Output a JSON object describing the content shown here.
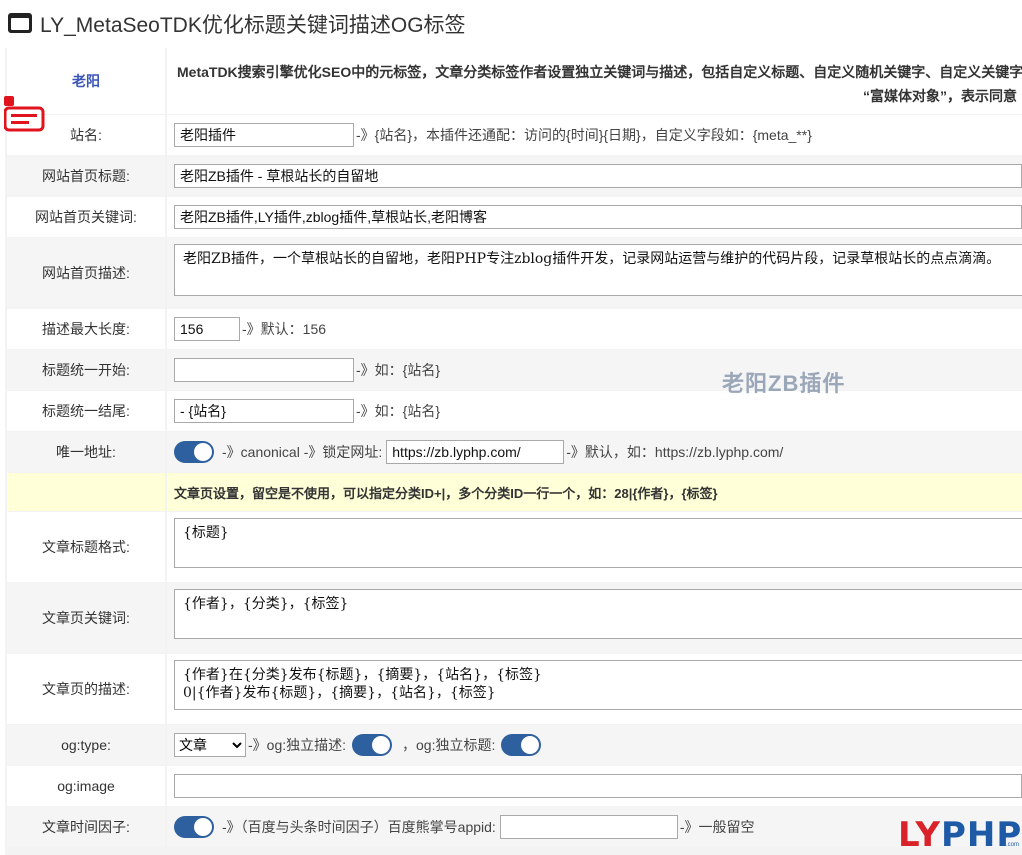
{
  "header": {
    "title": "LY_MetaSeoTDK优化标题关键词描述OG标签"
  },
  "intro": {
    "author": "老阳",
    "line1": "MetaTDK搜索引擎优化SEO中的元标签，文章分类标签作者设置独立关键词与描述，包括自定义标题、自定义随机关键字、自定义关键字",
    "line2": "“富媒体对象”，表示同意"
  },
  "rows": {
    "site_name": {
      "label": "站名:",
      "value": "老阳插件",
      "hint": "-》{站名}，本插件还通配：访问的{时间}{日期}，自定义字段如：{meta_**}"
    },
    "home_title": {
      "label": "网站首页标题:",
      "value": "老阳ZB插件 - 草根站长的自留地"
    },
    "home_keywords": {
      "label": "网站首页关键词:",
      "value": "老阳ZB插件,LY插件,zblog插件,草根站长,老阳博客"
    },
    "home_desc": {
      "label": "网站首页描述:",
      "value": "老阳ZB插件，一个草根站长的自留地，老阳PHP专注zblog插件开发，记录网站运营与维护的代码片段，记录草根站长的点点滴滴。"
    },
    "desc_maxlen": {
      "label": "描述最大长度:",
      "value": "156",
      "hint": "-》默认：156"
    },
    "title_prefix": {
      "label": "标题统一开始:",
      "value": "",
      "hint": "-》如：{站名}"
    },
    "title_suffix": {
      "label": "标题统一结尾:",
      "value": "- {站名}",
      "hint": "-》如：{站名}"
    },
    "canonical": {
      "label": "唯一地址:",
      "hint1": "-》canonical -》锁定网址:",
      "value": "https://zb.lyphp.com/",
      "hint2": "-》默认，如：https://zb.lyphp.com/"
    },
    "article_note": {
      "text": "文章页设置，留空是不使用，可以指定分类ID+|，多个分类ID一行一个，如：28|{作者}，{标签}"
    },
    "article_title": {
      "label": "文章标题格式:",
      "value": "{标题}"
    },
    "article_keywords": {
      "label": "文章页关键词:",
      "value": "{作者}，{分类}，{标签}"
    },
    "article_desc": {
      "label": "文章页的描述:",
      "value": "{作者}在{分类}发布{标题}，{摘要}，{站名}，{标签}\n0|{作者}发布{标题}，{摘要}，{站名}，{标签}"
    },
    "og_type": {
      "label": "og:type:",
      "selected": "文章",
      "hint1": "-》og:独立描述:",
      "hint2": "，og:独立标题:"
    },
    "og_image": {
      "label": "og:image",
      "value": ""
    },
    "time_factor": {
      "label": "文章时间因子:",
      "hint1": "-》（百度与头条时间因子）百度熊掌号appid:",
      "value": "",
      "hint2": "-》一般留空"
    }
  },
  "watermark": "老阳ZB插件",
  "brand": {
    "ly": "LY",
    "php": "PHP",
    "sub": ".com"
  }
}
